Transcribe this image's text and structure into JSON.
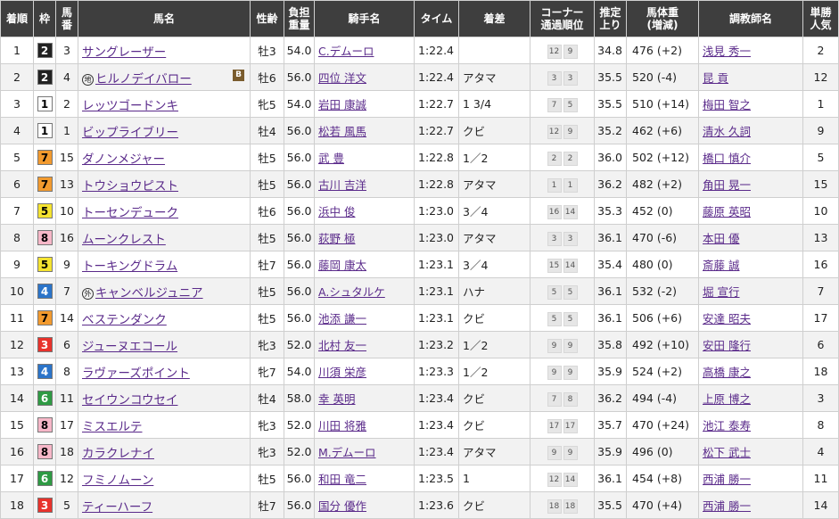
{
  "headers": {
    "rank": "着順",
    "waku": "枠",
    "umaban": "馬番",
    "horse": "馬名",
    "sexage": "性齢",
    "weight": "負担重量",
    "jockey": "騎手名",
    "time": "タイム",
    "margin": "着差",
    "corner": "コーナー通過順位",
    "last3f": "推定上り",
    "body": "馬体重(増減)",
    "trainer": "調教師名",
    "pop": "単勝人気"
  },
  "colors": {
    "header_bg": "#3e3e3e",
    "link": "#5a2a8a"
  },
  "waku_colors": {
    "1": {
      "bg": "#ffffff",
      "fg": "#000000"
    },
    "2": {
      "bg": "#222222",
      "fg": "#ffffff"
    },
    "3": {
      "bg": "#e8322c",
      "fg": "#ffffff"
    },
    "4": {
      "bg": "#2b74c9",
      "fg": "#ffffff"
    },
    "5": {
      "bg": "#f5e330",
      "fg": "#000000"
    },
    "6": {
      "bg": "#2e9a43",
      "fg": "#ffffff"
    },
    "7": {
      "bg": "#f29a2e",
      "fg": "#000000"
    },
    "8": {
      "bg": "#f7b7c8",
      "fg": "#000000"
    }
  },
  "rows": [
    {
      "rank": "1",
      "waku": "2",
      "umaban": "3",
      "prefix": "",
      "horse": "サングレーザー",
      "blinker": "",
      "sexage": "牡3",
      "weight": "54.0",
      "jockey": "C.デムーロ",
      "time": "1:22.4",
      "margin": "",
      "c1": "12",
      "c2": "9",
      "last3f": "34.8",
      "body": "476 (+2)",
      "trainer": "浅見 秀一",
      "pop": "2"
    },
    {
      "rank": "2",
      "waku": "2",
      "umaban": "4",
      "prefix": "地",
      "horse": "ヒルノデイバロー",
      "blinker": "B",
      "sexage": "牡6",
      "weight": "56.0",
      "jockey": "四位 洋文",
      "time": "1:22.4",
      "margin": "アタマ",
      "c1": "3",
      "c2": "3",
      "last3f": "35.5",
      "body": "520 (-4)",
      "trainer": "昆 貢",
      "pop": "12"
    },
    {
      "rank": "3",
      "waku": "1",
      "umaban": "2",
      "prefix": "",
      "horse": "レッツゴードンキ",
      "blinker": "",
      "sexage": "牝5",
      "weight": "54.0",
      "jockey": "岩田 康誠",
      "time": "1:22.7",
      "margin": "1 3/4",
      "c1": "7",
      "c2": "5",
      "last3f": "35.5",
      "body": "510 (+14)",
      "trainer": "梅田 智之",
      "pop": "1"
    },
    {
      "rank": "4",
      "waku": "1",
      "umaban": "1",
      "prefix": "",
      "horse": "ビップライブリー",
      "blinker": "",
      "sexage": "牡4",
      "weight": "56.0",
      "jockey": "松若 風馬",
      "time": "1:22.7",
      "margin": "クビ",
      "c1": "12",
      "c2": "9",
      "last3f": "35.2",
      "body": "462 (+6)",
      "trainer": "清水 久詞",
      "pop": "9"
    },
    {
      "rank": "5",
      "waku": "7",
      "umaban": "15",
      "prefix": "",
      "horse": "ダノンメジャー",
      "blinker": "",
      "sexage": "牡5",
      "weight": "56.0",
      "jockey": "武 豊",
      "time": "1:22.8",
      "margin": "1／2",
      "c1": "2",
      "c2": "2",
      "last3f": "36.0",
      "body": "502 (+12)",
      "trainer": "橋口 慎介",
      "pop": "5"
    },
    {
      "rank": "6",
      "waku": "7",
      "umaban": "13",
      "prefix": "",
      "horse": "トウショウピスト",
      "blinker": "",
      "sexage": "牡5",
      "weight": "56.0",
      "jockey": "古川 吉洋",
      "time": "1:22.8",
      "margin": "アタマ",
      "c1": "1",
      "c2": "1",
      "last3f": "36.2",
      "body": "482 (+2)",
      "trainer": "角田 晃一",
      "pop": "15"
    },
    {
      "rank": "7",
      "waku": "5",
      "umaban": "10",
      "prefix": "",
      "horse": "トーセンデューク",
      "blinker": "",
      "sexage": "牡6",
      "weight": "56.0",
      "jockey": "浜中 俊",
      "time": "1:23.0",
      "margin": "3／4",
      "c1": "16",
      "c2": "14",
      "last3f": "35.3",
      "body": "452 (0)",
      "trainer": "藤原 英昭",
      "pop": "10"
    },
    {
      "rank": "8",
      "waku": "8",
      "umaban": "16",
      "prefix": "",
      "horse": "ムーンクレスト",
      "blinker": "",
      "sexage": "牡5",
      "weight": "56.0",
      "jockey": "荻野 極",
      "time": "1:23.0",
      "margin": "アタマ",
      "c1": "3",
      "c2": "3",
      "last3f": "36.1",
      "body": "470 (-6)",
      "trainer": "本田 優",
      "pop": "13"
    },
    {
      "rank": "9",
      "waku": "5",
      "umaban": "9",
      "prefix": "",
      "horse": "トーキングドラム",
      "blinker": "",
      "sexage": "牡7",
      "weight": "56.0",
      "jockey": "藤岡 康太",
      "time": "1:23.1",
      "margin": "3／4",
      "c1": "15",
      "c2": "14",
      "last3f": "35.4",
      "body": "480 (0)",
      "trainer": "斎藤 誠",
      "pop": "16"
    },
    {
      "rank": "10",
      "waku": "4",
      "umaban": "7",
      "prefix": "外",
      "horse": "キャンベルジュニア",
      "blinker": "",
      "sexage": "牡5",
      "weight": "56.0",
      "jockey": "A.シュタルケ",
      "time": "1:23.1",
      "margin": "ハナ",
      "c1": "5",
      "c2": "5",
      "last3f": "36.1",
      "body": "532 (-2)",
      "trainer": "堀 宣行",
      "pop": "7"
    },
    {
      "rank": "11",
      "waku": "7",
      "umaban": "14",
      "prefix": "",
      "horse": "ベステンダンク",
      "blinker": "",
      "sexage": "牡5",
      "weight": "56.0",
      "jockey": "池添 謙一",
      "time": "1:23.1",
      "margin": "クビ",
      "c1": "5",
      "c2": "5",
      "last3f": "36.1",
      "body": "506 (+6)",
      "trainer": "安達 昭夫",
      "pop": "17"
    },
    {
      "rank": "12",
      "waku": "3",
      "umaban": "6",
      "prefix": "",
      "horse": "ジューヌエコール",
      "blinker": "",
      "sexage": "牝3",
      "weight": "52.0",
      "jockey": "北村 友一",
      "time": "1:23.2",
      "margin": "1／2",
      "c1": "9",
      "c2": "9",
      "last3f": "35.8",
      "body": "492 (+10)",
      "trainer": "安田 隆行",
      "pop": "6"
    },
    {
      "rank": "13",
      "waku": "4",
      "umaban": "8",
      "prefix": "",
      "horse": "ラヴァーズポイント",
      "blinker": "",
      "sexage": "牝7",
      "weight": "54.0",
      "jockey": "川須 栄彦",
      "time": "1:23.3",
      "margin": "1／2",
      "c1": "9",
      "c2": "9",
      "last3f": "35.9",
      "body": "524 (+2)",
      "trainer": "高橋 康之",
      "pop": "18"
    },
    {
      "rank": "14",
      "waku": "6",
      "umaban": "11",
      "prefix": "",
      "horse": "セイウンコウセイ",
      "blinker": "",
      "sexage": "牡4",
      "weight": "58.0",
      "jockey": "幸 英明",
      "time": "1:23.4",
      "margin": "クビ",
      "c1": "7",
      "c2": "8",
      "last3f": "36.2",
      "body": "494 (-4)",
      "trainer": "上原 博之",
      "pop": "3"
    },
    {
      "rank": "15",
      "waku": "8",
      "umaban": "17",
      "prefix": "",
      "horse": "ミスエルテ",
      "blinker": "",
      "sexage": "牝3",
      "weight": "52.0",
      "jockey": "川田 将雅",
      "time": "1:23.4",
      "margin": "クビ",
      "c1": "17",
      "c2": "17",
      "last3f": "35.7",
      "body": "470 (+24)",
      "trainer": "池江 泰寿",
      "pop": "8"
    },
    {
      "rank": "16",
      "waku": "8",
      "umaban": "18",
      "prefix": "",
      "horse": "カラクレナイ",
      "blinker": "",
      "sexage": "牝3",
      "weight": "52.0",
      "jockey": "M.デムーロ",
      "time": "1:23.4",
      "margin": "アタマ",
      "c1": "9",
      "c2": "9",
      "last3f": "35.9",
      "body": "496 (0)",
      "trainer": "松下 武士",
      "pop": "4"
    },
    {
      "rank": "17",
      "waku": "6",
      "umaban": "12",
      "prefix": "",
      "horse": "フミノムーン",
      "blinker": "",
      "sexage": "牡5",
      "weight": "56.0",
      "jockey": "和田 竜二",
      "time": "1:23.5",
      "margin": "1",
      "c1": "12",
      "c2": "14",
      "last3f": "36.1",
      "body": "454 (+8)",
      "trainer": "西浦 勝一",
      "pop": "11"
    },
    {
      "rank": "18",
      "waku": "3",
      "umaban": "5",
      "prefix": "",
      "horse": "ティーハーフ",
      "blinker": "",
      "sexage": "牡7",
      "weight": "56.0",
      "jockey": "国分 優作",
      "time": "1:23.6",
      "margin": "クビ",
      "c1": "18",
      "c2": "18",
      "last3f": "35.5",
      "body": "470 (+4)",
      "trainer": "西浦 勝一",
      "pop": "14"
    }
  ]
}
